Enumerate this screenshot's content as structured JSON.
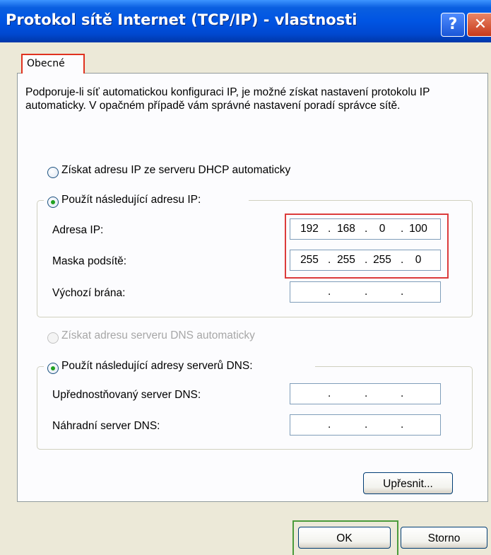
{
  "window": {
    "title": "Protokol sítě Internet (TCP/IP) - vlastnosti",
    "help_label": "?",
    "close_label": "✕"
  },
  "tabs": [
    {
      "label": "Obecné",
      "active": true
    }
  ],
  "intro_text": "Podporuje-li síť automatickou konfiguraci IP, je možné získat nastavení protokolu IP automaticky. V opačném případě vám správné nastavení poradí správce sítě.",
  "ip_section": {
    "auto_label": "Získat adresu IP ze serveru DHCP automaticky",
    "manual_label": "Použít následující adresu IP:",
    "selected": "manual",
    "fields": [
      {
        "label": "Adresa IP:",
        "octets": [
          "192",
          "168",
          "0",
          "100"
        ]
      },
      {
        "label": "Maska podsítě:",
        "octets": [
          "255",
          "255",
          "255",
          "0"
        ]
      },
      {
        "label": "Výchozí brána:",
        "octets": [
          "",
          "",
          "",
          ""
        ]
      }
    ]
  },
  "dns_section": {
    "auto_label": "Získat adresu serveru DNS automaticky",
    "auto_enabled": false,
    "manual_label": "Použít následující adresy serverů DNS:",
    "selected": "manual",
    "fields": [
      {
        "label": "Upřednostňovaný server DNS:",
        "octets": [
          "",
          "",
          "",
          ""
        ]
      },
      {
        "label": "Náhradní server DNS:",
        "octets": [
          "",
          "",
          "",
          ""
        ]
      }
    ]
  },
  "buttons": {
    "advanced": "Upřesnit...",
    "ok": "OK",
    "cancel": "Storno"
  },
  "colors": {
    "titlebar": "#0054e3",
    "highlight_red": "#dc3b3b",
    "highlight_green": "#4b9b3b",
    "radio_checked": "#21a121"
  }
}
